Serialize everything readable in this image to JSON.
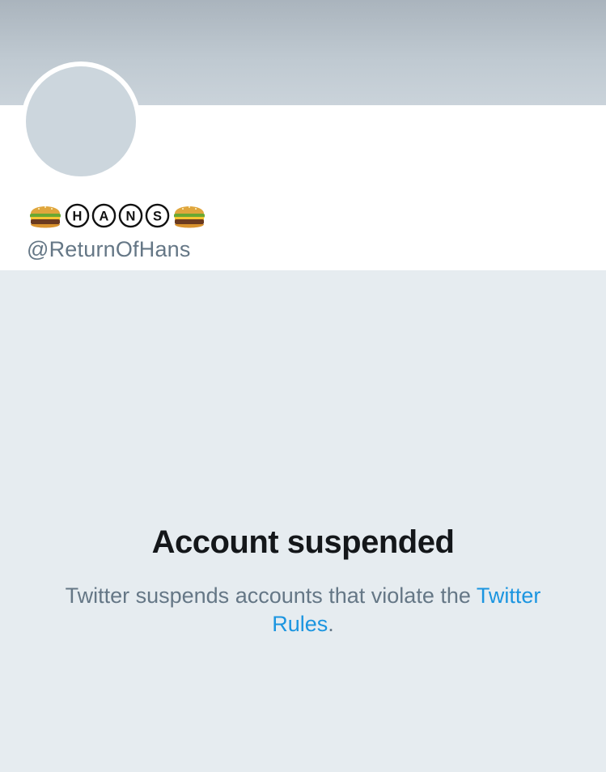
{
  "profile": {
    "display_name_parts": [
      "🍔",
      "H",
      "A",
      "N",
      "S",
      "🍔"
    ],
    "username": "@ReturnOfHans"
  },
  "suspension": {
    "title": "Account suspended",
    "message": "Twitter suspends accounts that violate the",
    "link_text": "Twitter Rules",
    "trailing_punctuation": "."
  },
  "colors": {
    "banner": "#b4bec6",
    "page_background": "#e6ecf0",
    "avatar_placeholder": "#ccd6dd",
    "secondary_text": "#657786",
    "primary_text": "#14171a",
    "link": "#1b95e0"
  },
  "icons": {
    "burger": "hamburger-emoji-icon",
    "letters": "circled-letter-icon"
  }
}
